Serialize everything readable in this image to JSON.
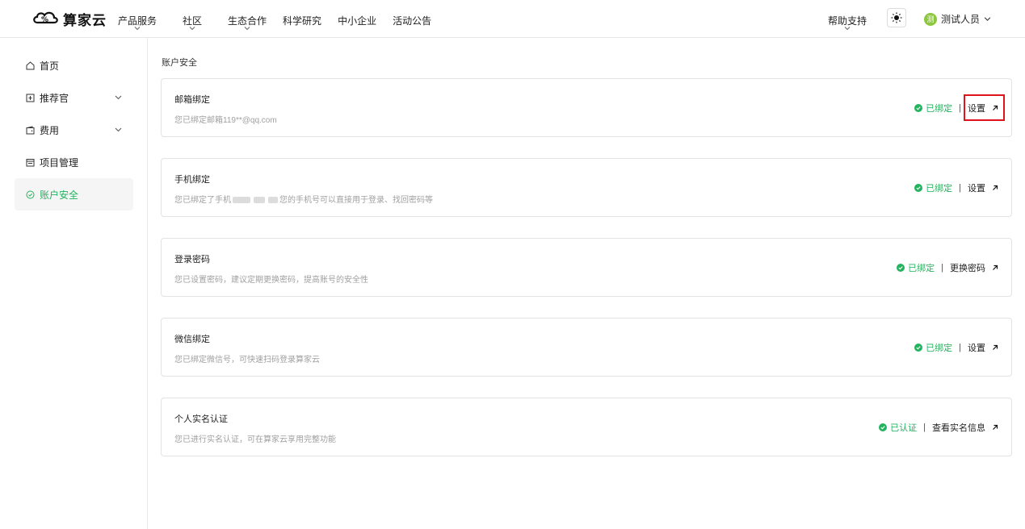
{
  "brand": {
    "name": "算家云"
  },
  "nav": [
    {
      "label": "产品服务",
      "dropdown": true
    },
    {
      "label": "社区",
      "dropdown": true
    },
    {
      "label": "生态合作",
      "dropdown": true
    },
    {
      "label": "科学研究",
      "dropdown": false
    },
    {
      "label": "中小企业",
      "dropdown": false
    },
    {
      "label": "活动公告",
      "dropdown": false
    }
  ],
  "header": {
    "help_label": "帮助支持",
    "user_name": "测试人员",
    "avatar_text": "测"
  },
  "sidebar": {
    "items": [
      {
        "label": "首页",
        "icon": "home-icon"
      },
      {
        "label": "推荐官",
        "icon": "recommend-icon",
        "expandable": true
      },
      {
        "label": "费用",
        "icon": "wallet-icon",
        "expandable": true
      },
      {
        "label": "项目管理",
        "icon": "project-icon"
      },
      {
        "label": "账户安全",
        "icon": "shield-icon",
        "active": true
      }
    ]
  },
  "breadcrumb": "账户安全",
  "cards": [
    {
      "title": "邮箱绑定",
      "desc": "您已绑定邮箱119**@qq.com",
      "status": "已绑定",
      "action": "设置"
    },
    {
      "title": "手机绑定",
      "desc_prefix": "您已绑定了手机",
      "desc_suffix": "您的手机号可以直接用于登录、找回密码等",
      "status": "已绑定",
      "action": "设置"
    },
    {
      "title": "登录密码",
      "desc": "您已设置密码，建议定期更换密码，提高账号的安全性",
      "status": "已绑定",
      "action": "更换密码"
    },
    {
      "title": "微信绑定",
      "desc": "您已绑定微信号，可快速扫码登录算家云",
      "status": "已绑定",
      "action": "设置"
    },
    {
      "title": "个人实名认证",
      "desc": "您已进行实名认证，可在算家云享用完整功能",
      "status": "已认证",
      "action": "查看实名信息"
    }
  ],
  "colors": {
    "accent": "#22b35e",
    "highlight": "#e0131a"
  }
}
